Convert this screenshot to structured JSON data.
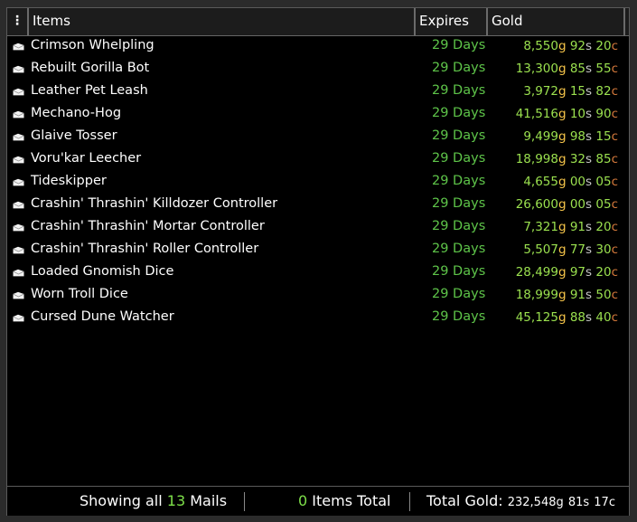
{
  "header": {
    "menu_icon": "⋮",
    "col_items": "Items",
    "col_expires": "Expires",
    "col_gold": "Gold"
  },
  "rows": [
    {
      "name": "Crimson Whelpling",
      "expires": "29 Days",
      "gold": "8,550",
      "silver": "92",
      "copper": "20"
    },
    {
      "name": "Rebuilt Gorilla Bot",
      "expires": "29 Days",
      "gold": "13,300",
      "silver": "85",
      "copper": "55"
    },
    {
      "name": "Leather Pet Leash",
      "expires": "29 Days",
      "gold": "3,972",
      "silver": "15",
      "copper": "82"
    },
    {
      "name": "Mechano-Hog",
      "expires": "29 Days",
      "gold": "41,516",
      "silver": "10",
      "copper": "90"
    },
    {
      "name": "Glaive Tosser",
      "expires": "29 Days",
      "gold": "9,499",
      "silver": "98",
      "copper": "15"
    },
    {
      "name": "Voru'kar Leecher",
      "expires": "29 Days",
      "gold": "18,998",
      "silver": "32",
      "copper": "85"
    },
    {
      "name": "Tideskipper",
      "expires": "29 Days",
      "gold": "4,655",
      "silver": "00",
      "copper": "05"
    },
    {
      "name": "Crashin' Thrashin' Killdozer Controller",
      "expires": "29 Days",
      "gold": "26,600",
      "silver": "00",
      "copper": "05"
    },
    {
      "name": "Crashin' Thrashin' Mortar Controller",
      "expires": "29 Days",
      "gold": "7,321",
      "silver": "91",
      "copper": "20"
    },
    {
      "name": "Crashin' Thrashin' Roller Controller",
      "expires": "29 Days",
      "gold": "5,507",
      "silver": "77",
      "copper": "30"
    },
    {
      "name": "Loaded Gnomish Dice",
      "expires": "29 Days",
      "gold": "28,499",
      "silver": "97",
      "copper": "20"
    },
    {
      "name": "Worn Troll Dice",
      "expires": "29 Days",
      "gold": "18,999",
      "silver": "91",
      "copper": "50"
    },
    {
      "name": "Cursed Dune Watcher",
      "expires": "29 Days",
      "gold": "45,125",
      "silver": "88",
      "copper": "40"
    }
  ],
  "currency": {
    "g": "g",
    "s": "s",
    "c": "c"
  },
  "footer": {
    "showing_prefix": "Showing all",
    "mail_count": "13",
    "mail_suffix": "Mails",
    "items_count": "0",
    "items_suffix": "Items Total",
    "total_label": "Total Gold:",
    "total_gold": "232,548",
    "total_silver": "81",
    "total_copper": "17"
  },
  "colors": {
    "expires_green": "#5ec449",
    "gold_amount": "#9be14f",
    "gold_symbol": "#f7c64a",
    "silver_symbol": "#c8c8c8",
    "copper_symbol": "#d77a3c"
  },
  "icons": {
    "row_icon": "mail-envelope-icon",
    "menu": "vertical-dots-icon"
  }
}
